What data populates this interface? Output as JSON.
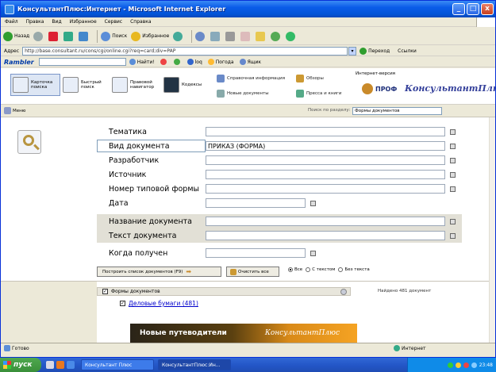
{
  "window": {
    "title": "КонсультантПлюс:Интернет - Microsoft Internet Explorer",
    "minimize": "_",
    "maximize": "□",
    "close": "x"
  },
  "menubar": [
    "Файл",
    "Правка",
    "Вид",
    "Избранное",
    "Сервис",
    "Справка"
  ],
  "toolbar": {
    "back": "Назад",
    "search": "Поиск",
    "favorites": "Избранное"
  },
  "address": {
    "label": "Адрес",
    "url": "http://base.consultant.ru/cons/cgi/online.cgi?req=card;div=PAP",
    "go": "Переход",
    "links": "Ссылки"
  },
  "rambler": {
    "logo": "Rambler",
    "find": "Найти!",
    "items": [
      "loq",
      "Погода",
      "Ящик"
    ]
  },
  "kp_toolbar": {
    "card": "Карточка поиска",
    "quick": "Быстрый поиск",
    "legal": "Правовой навигатор",
    "codes": "Кодексы",
    "refinfo": "Справочная информация",
    "overview": "Обзоры",
    "new_docs": "Новые документы",
    "press": "Пресса и книги",
    "inet_label": "Интернет-версия",
    "prof": "ПРОФ",
    "brand": "КонсультантПлюс"
  },
  "menu_row": {
    "menu": "Меню",
    "search_label": "Поиск по разделу:",
    "search_value": "Формы документов"
  },
  "fields": [
    {
      "label": "Тематика",
      "value": ""
    },
    {
      "label": "Вид документа",
      "value": "ПРИКАЗ (ФОРМА)"
    },
    {
      "label": "Разработчик",
      "value": ""
    },
    {
      "label": "Источник",
      "value": ""
    },
    {
      "label": "Номер типовой формы",
      "value": ""
    },
    {
      "label": "Дата",
      "value": ""
    },
    {
      "label": "Название документа",
      "value": ""
    },
    {
      "label": "Текст документа",
      "value": ""
    },
    {
      "label": "Когда получен",
      "value": ""
    }
  ],
  "actions": {
    "build": "Построить список документов (F9)",
    "clear": "Очистить все",
    "radios": [
      "Все",
      "С текстом",
      "Без текста"
    ]
  },
  "results": {
    "section": "Формы документов",
    "found": "Найдено 481 документ",
    "item": "Деловые бумаги (481)"
  },
  "banner": {
    "left": "Новые путеводители",
    "right": "КонсультантПлюс"
  },
  "status": {
    "text": "Готово",
    "zone": "Интернет"
  },
  "taskbar": {
    "start": "пуск",
    "tasks": [
      "Консультант Плюс",
      "КонсультантПлюс:Ин..."
    ],
    "clock": "23:48"
  }
}
